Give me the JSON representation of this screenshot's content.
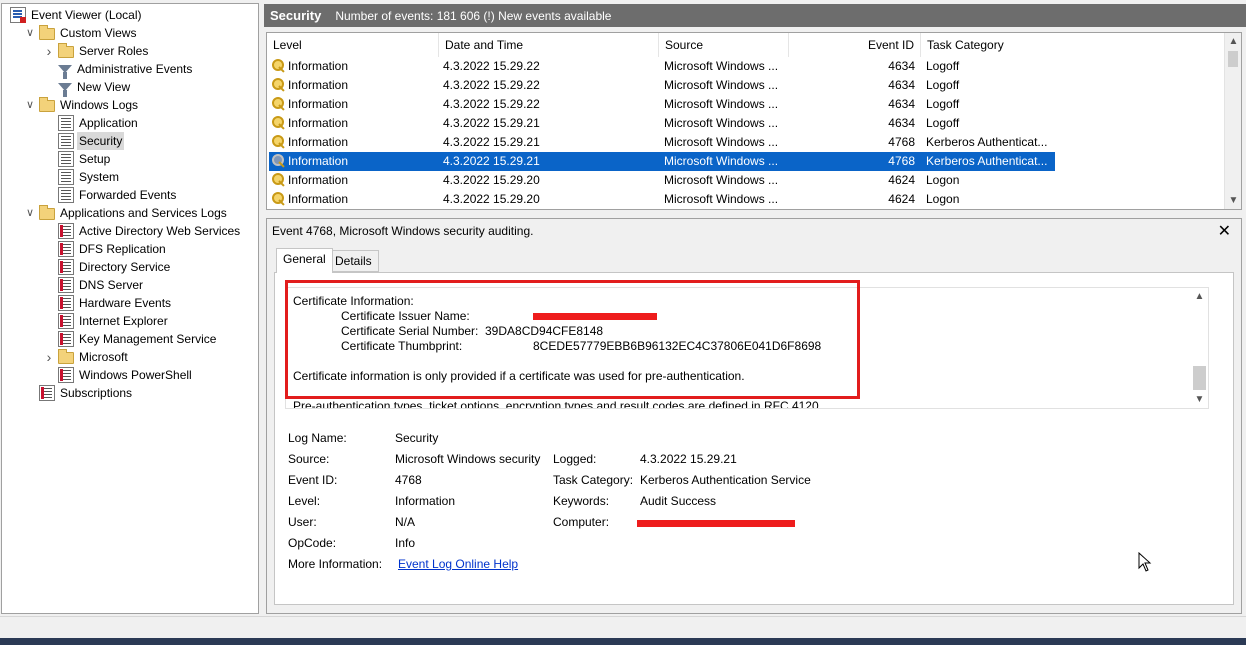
{
  "tree": {
    "items": [
      {
        "label": "Event Viewer (Local)",
        "icon": "event-viewer-icon",
        "toggle": ""
      },
      {
        "label": "Custom Views",
        "icon": "folder-icon",
        "toggle": "expanded"
      },
      {
        "label": "Server Roles",
        "icon": "folder-icon",
        "toggle": "collapsed"
      },
      {
        "label": "Administrative Events",
        "icon": "filter-icon",
        "toggle": ""
      },
      {
        "label": "New View",
        "icon": "filter-icon",
        "toggle": ""
      },
      {
        "label": "Windows Logs",
        "icon": "folder-icon",
        "toggle": "expanded"
      },
      {
        "label": "Application",
        "icon": "log-icon",
        "toggle": ""
      },
      {
        "label": "Security",
        "icon": "log-icon",
        "toggle": "",
        "selected": true
      },
      {
        "label": "Setup",
        "icon": "log-icon",
        "toggle": ""
      },
      {
        "label": "System",
        "icon": "log-icon",
        "toggle": ""
      },
      {
        "label": "Forwarded Events",
        "icon": "log-icon",
        "toggle": ""
      },
      {
        "label": "Applications and Services Logs",
        "icon": "folder-icon",
        "toggle": "expanded"
      },
      {
        "label": "Active Directory Web Services",
        "icon": "log-icon",
        "toggle": ""
      },
      {
        "label": "DFS Replication",
        "icon": "log-icon",
        "toggle": ""
      },
      {
        "label": "Directory Service",
        "icon": "log-icon",
        "toggle": ""
      },
      {
        "label": "DNS Server",
        "icon": "log-icon",
        "toggle": ""
      },
      {
        "label": "Hardware Events",
        "icon": "log-icon",
        "toggle": ""
      },
      {
        "label": "Internet Explorer",
        "icon": "log-icon",
        "toggle": ""
      },
      {
        "label": "Key Management Service",
        "icon": "log-icon",
        "toggle": ""
      },
      {
        "label": "Microsoft",
        "icon": "folder-icon",
        "toggle": "collapsed"
      },
      {
        "label": "Windows PowerShell",
        "icon": "log-icon",
        "toggle": ""
      },
      {
        "label": "Subscriptions",
        "icon": "log-icon",
        "toggle": ""
      }
    ]
  },
  "header": {
    "title": "Security",
    "summary": "Number of events: 181 606 (!) New events available"
  },
  "list": {
    "columns": [
      "Level",
      "Date and Time",
      "Source",
      "Event ID",
      "Task Category"
    ],
    "rows": [
      {
        "level": "Information",
        "date": "4.3.2022 15.29.22",
        "source": "Microsoft Windows ...",
        "id": "4634",
        "category": "Logoff"
      },
      {
        "level": "Information",
        "date": "4.3.2022 15.29.22",
        "source": "Microsoft Windows ...",
        "id": "4634",
        "category": "Logoff"
      },
      {
        "level": "Information",
        "date": "4.3.2022 15.29.22",
        "source": "Microsoft Windows ...",
        "id": "4634",
        "category": "Logoff"
      },
      {
        "level": "Information",
        "date": "4.3.2022 15.29.21",
        "source": "Microsoft Windows ...",
        "id": "4634",
        "category": "Logoff"
      },
      {
        "level": "Information",
        "date": "4.3.2022 15.29.21",
        "source": "Microsoft Windows ...",
        "id": "4768",
        "category": "Kerberos Authenticat..."
      },
      {
        "level": "Information",
        "date": "4.3.2022 15.29.21",
        "source": "Microsoft Windows ...",
        "id": "4768",
        "category": "Kerberos Authenticat...",
        "selected": true
      },
      {
        "level": "Information",
        "date": "4.3.2022 15.29.20",
        "source": "Microsoft Windows ...",
        "id": "4624",
        "category": "Logon"
      },
      {
        "level": "Information",
        "date": "4.3.2022 15.29.20",
        "source": "Microsoft Windows ...",
        "id": "4624",
        "category": "Logon"
      }
    ]
  },
  "detail": {
    "title": "Event 4768, Microsoft Windows security auditing.",
    "tabs": [
      "General",
      "Details"
    ],
    "description": {
      "heading": "Certificate Information:",
      "issuer_label": "Certificate Issuer Name:",
      "serial_label": "Certificate Serial Number:",
      "serial_value": "39DA8CD94CFE8148",
      "thumb_label": "Certificate Thumbprint:",
      "thumb_value": "8CEDE57779EBB6B96132EC4C37806E041D6F8698",
      "note": "Certificate information is only provided if a certificate was used for pre-authentication.",
      "footer": "Pre-authentication types, ticket options, encryption types and result codes are defined in RFC 4120."
    },
    "fields": {
      "log_name_label": "Log Name:",
      "log_name": "Security",
      "source_label": "Source:",
      "source": "Microsoft Windows security",
      "logged_label": "Logged:",
      "logged": "4.3.2022 15.29.21",
      "event_id_label": "Event ID:",
      "event_id": "4768",
      "task_category_label": "Task Category:",
      "task_category": "Kerberos Authentication Service",
      "level_label": "Level:",
      "level": "Information",
      "keywords_label": "Keywords:",
      "keywords": "Audit Success",
      "user_label": "User:",
      "user": "N/A",
      "computer_label": "Computer:",
      "opcode_label": "OpCode:",
      "opcode": "Info",
      "more_info_label": "More Information:",
      "more_info_link": "Event Log Online Help"
    }
  },
  "colors": {
    "selection": "#0a64c8",
    "header_bg": "#6d6d6d",
    "annotation_red": "#e21d1d",
    "link": "#0033cc"
  }
}
